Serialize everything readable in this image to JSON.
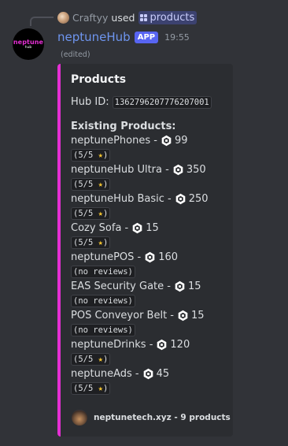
{
  "reply": {
    "username": "Craftyy",
    "verb": "used",
    "command": "products"
  },
  "message": {
    "author": "neptuneHub",
    "badge": "APP",
    "time": "19:55",
    "edited": "(edited)",
    "avatar_text_top": "neptune",
    "avatar_text_bottom": "hub"
  },
  "embed": {
    "accent_color": "#e52fd4",
    "title": "Products",
    "hub_id_label": "Hub ID:",
    "hub_id": "1362796207776207001",
    "section_title": "Existing Products:",
    "products": [
      {
        "name": "neptunePhones -",
        "price": "99",
        "rating": "(5/5 ⭐)"
      },
      {
        "name": "neptuneHub Ultra -",
        "price": "350",
        "rating": "(5/5 ⭐)"
      },
      {
        "name": "neptuneHub Basic -",
        "price": "250",
        "rating": "(5/5 ⭐)"
      },
      {
        "name": "Cozy Sofa -",
        "price": "15",
        "rating": "(5/5 ⭐)"
      },
      {
        "name": "neptunePOS -",
        "price": "160",
        "rating": "(no reviews)"
      },
      {
        "name": "EAS Security Gate -",
        "price": "15",
        "rating": "(no reviews)"
      },
      {
        "name": "POS Conveyor Belt -",
        "price": "15",
        "rating": "(no reviews)"
      },
      {
        "name": "neptuneDrinks -",
        "price": "120",
        "rating": "(5/5 ⭐)"
      },
      {
        "name": "neptuneAds -",
        "price": "45",
        "rating": "(5/5 ⭐)"
      }
    ],
    "footer": "neptunetech.xyz - 9 products"
  },
  "icons": {
    "currency": "robux-icon",
    "command": "slash-command-icon"
  }
}
